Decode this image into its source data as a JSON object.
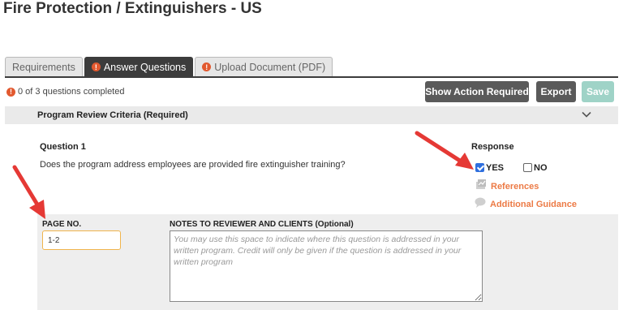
{
  "page_title": "Fire Protection / Extinguishers - US",
  "tabs": [
    {
      "label": "Requirements",
      "warning": false,
      "active": false
    },
    {
      "label": "Answer Questions",
      "warning": true,
      "active": true
    },
    {
      "label": "Upload Document (PDF)",
      "warning": true,
      "active": false
    }
  ],
  "progress_text": "0 of 3 questions completed",
  "buttons": {
    "show_action_required": "Show Action Required",
    "export": "Export",
    "save": "Save"
  },
  "section": {
    "title": "Program Review Criteria (Required)",
    "collapse_icon": "chevron-down-icon"
  },
  "question": {
    "label": "Question 1",
    "text": "Does the program address employees are provided fire extinguisher training?",
    "response_label": "Response",
    "yes_label": "YES",
    "no_label": "NO",
    "yes_checked": true,
    "no_checked": false,
    "references_label": "References",
    "guidance_label": "Additional Guidance"
  },
  "notes": {
    "page_no_label": "PAGE NO.",
    "page_no_value": "1-2",
    "notes_label": "NOTES TO REVIEWER AND CLIENTS (Optional)",
    "notes_placeholder": "You may use this space to indicate where this question is addressed in your written program. Credit will only be given if the question is addressed in your written program"
  },
  "colors": {
    "accent_orange": "#ec7a45",
    "warning_icon": "#e2592f",
    "dark_button": "#5a5a5a",
    "save_button": "#9fd3c7",
    "annotation_arrow": "#e53935"
  }
}
